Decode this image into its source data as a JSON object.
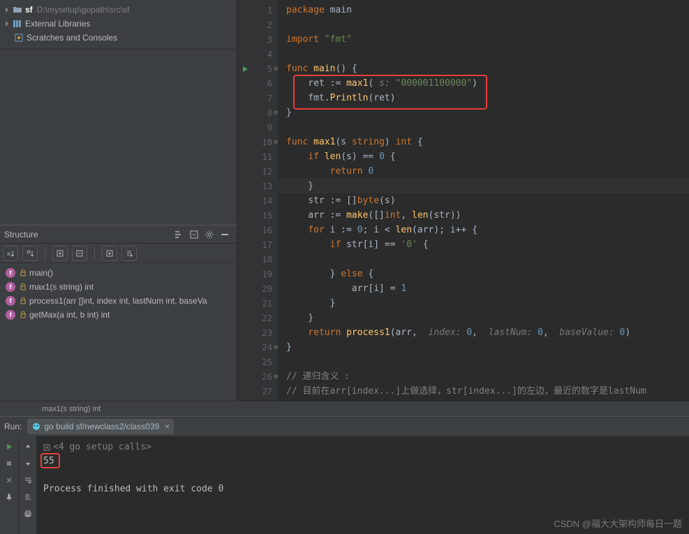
{
  "project": {
    "root_name": "sf",
    "root_path": "D:\\mysetup\\gopath\\src\\sf",
    "external_libs": "External Libraries",
    "scratches": "Scratches and Consoles"
  },
  "structure": {
    "title": "Structure",
    "items": [
      {
        "label": "main()"
      },
      {
        "label": "max1(s string) int"
      },
      {
        "label": "process1(arr []int, index int, lastNum int, baseVa"
      },
      {
        "label": "getMax(a int, b int) int"
      }
    ]
  },
  "code": {
    "lines": [
      {
        "n": 1,
        "tokens": [
          [
            "kw",
            "package "
          ],
          [
            "ident",
            "main"
          ]
        ]
      },
      {
        "n": 2,
        "tokens": []
      },
      {
        "n": 3,
        "tokens": [
          [
            "kw",
            "import "
          ],
          [
            "str",
            "\"fmt\""
          ]
        ]
      },
      {
        "n": 4,
        "tokens": []
      },
      {
        "n": 5,
        "tokens": [
          [
            "kw",
            "func "
          ],
          [
            "fn",
            "main"
          ],
          [
            "ident",
            "() {"
          ]
        ],
        "run": true,
        "fold": "-"
      },
      {
        "n": 6,
        "tokens": [
          [
            "ident",
            "    ret := "
          ],
          [
            "fn",
            "max1"
          ],
          [
            "ident",
            "( "
          ],
          [
            "param-hint",
            "s: "
          ],
          [
            "str",
            "\"000001100000\""
          ],
          [
            "ident",
            ")"
          ]
        ]
      },
      {
        "n": 7,
        "tokens": [
          [
            "ident",
            "    fmt."
          ],
          [
            "fn",
            "Println"
          ],
          [
            "ident",
            "(ret)"
          ]
        ]
      },
      {
        "n": 8,
        "tokens": [
          [
            "ident",
            "}"
          ]
        ],
        "fold": "-"
      },
      {
        "n": 9,
        "tokens": []
      },
      {
        "n": 10,
        "tokens": [
          [
            "kw",
            "func "
          ],
          [
            "fn",
            "max1"
          ],
          [
            "ident",
            "(s "
          ],
          [
            "kw",
            "string"
          ],
          [
            "ident",
            ") "
          ],
          [
            "kw",
            "int"
          ],
          [
            "ident",
            " {"
          ]
        ],
        "fold": "-"
      },
      {
        "n": 11,
        "tokens": [
          [
            "ident",
            "    "
          ],
          [
            "kw",
            "if "
          ],
          [
            "fn",
            "len"
          ],
          [
            "ident",
            "(s) == "
          ],
          [
            "num",
            "0"
          ],
          [
            "ident",
            " {"
          ]
        ]
      },
      {
        "n": 12,
        "tokens": [
          [
            "ident",
            "        "
          ],
          [
            "kw",
            "return "
          ],
          [
            "num",
            "0"
          ]
        ]
      },
      {
        "n": 13,
        "tokens": [
          [
            "ident",
            "    }"
          ]
        ],
        "current": true
      },
      {
        "n": 14,
        "tokens": [
          [
            "ident",
            "    str := []"
          ],
          [
            "kw",
            "byte"
          ],
          [
            "ident",
            "(s)"
          ]
        ]
      },
      {
        "n": 15,
        "tokens": [
          [
            "ident",
            "    arr := "
          ],
          [
            "fn",
            "make"
          ],
          [
            "ident",
            "([]"
          ],
          [
            "kw",
            "int"
          ],
          [
            "ident",
            ", "
          ],
          [
            "fn",
            "len"
          ],
          [
            "ident",
            "(str))"
          ]
        ]
      },
      {
        "n": 16,
        "tokens": [
          [
            "ident",
            "    "
          ],
          [
            "kw",
            "for "
          ],
          [
            "ident",
            "i := "
          ],
          [
            "num",
            "0"
          ],
          [
            "ident",
            "; i < "
          ],
          [
            "fn",
            "len"
          ],
          [
            "ident",
            "(arr); i++ {"
          ]
        ]
      },
      {
        "n": 17,
        "tokens": [
          [
            "ident",
            "        "
          ],
          [
            "kw",
            "if "
          ],
          [
            "ident",
            "str[i] == "
          ],
          [
            "str",
            "'0'"
          ],
          [
            "ident",
            " {"
          ]
        ]
      },
      {
        "n": 18,
        "tokens": []
      },
      {
        "n": 19,
        "tokens": [
          [
            "ident",
            "        } "
          ],
          [
            "kw",
            "else"
          ],
          [
            "ident",
            " {"
          ]
        ]
      },
      {
        "n": 20,
        "tokens": [
          [
            "ident",
            "            arr[i] = "
          ],
          [
            "num",
            "1"
          ]
        ]
      },
      {
        "n": 21,
        "tokens": [
          [
            "ident",
            "        }"
          ]
        ]
      },
      {
        "n": 22,
        "tokens": [
          [
            "ident",
            "    }"
          ]
        ]
      },
      {
        "n": 23,
        "tokens": [
          [
            "ident",
            "    "
          ],
          [
            "kw",
            "return "
          ],
          [
            "fn",
            "process1"
          ],
          [
            "ident",
            "(arr,  "
          ],
          [
            "param-hint",
            "index: "
          ],
          [
            "num",
            "0"
          ],
          [
            "ident",
            ",  "
          ],
          [
            "param-hint",
            "lastNum: "
          ],
          [
            "num",
            "0"
          ],
          [
            "ident",
            ",  "
          ],
          [
            "param-hint",
            "baseValue: "
          ],
          [
            "num",
            "0"
          ],
          [
            "ident",
            ")"
          ]
        ]
      },
      {
        "n": 24,
        "tokens": [
          [
            "ident",
            "}"
          ]
        ],
        "fold": "-"
      },
      {
        "n": 25,
        "tokens": []
      },
      {
        "n": 26,
        "tokens": [
          [
            "comment",
            "// 递归含义 :"
          ]
        ],
        "fold": "-"
      },
      {
        "n": 27,
        "tokens": [
          [
            "comment",
            "// 目前在arr[index...]上做选择，str[index...]的左边，最近的数字是lastNum"
          ]
        ]
      }
    ],
    "breadcrumb": "max1(s string) int"
  },
  "run": {
    "panel_label": "Run:",
    "tab": "go build sf/newclass2/class039",
    "setup_line": "<4 go setup calls>",
    "output": "55",
    "exit_line": "Process finished with exit code 0"
  },
  "watermark": "CSDN @福大大架构师每日一题"
}
